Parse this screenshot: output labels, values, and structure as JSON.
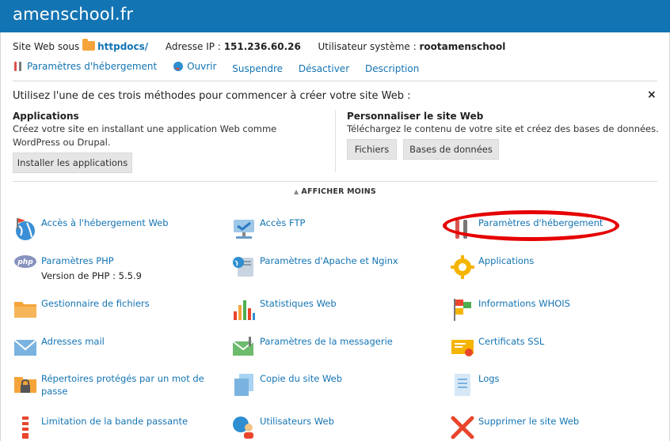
{
  "header": {
    "title": "amenschool.fr"
  },
  "info": {
    "site_label": "Site Web sous",
    "site_folder": "httpdocs/",
    "ip_label": "Adresse IP :",
    "ip_value": "151.236.60.26",
    "user_label": "Utilisateur système :",
    "user_value": "rootamenschool"
  },
  "actions": [
    {
      "label": "Paramètres d'hébergement",
      "icon": "tools-icon"
    },
    {
      "label": "Ouvrir",
      "icon": "globe-open-icon"
    },
    {
      "label": "Suspendre"
    },
    {
      "label": "Désactiver"
    },
    {
      "label": "Description"
    }
  ],
  "methods": {
    "title": "Utilisez l'une de ces trois méthodes pour commencer à créer votre site Web :",
    "close": "×",
    "applications": {
      "heading": "Applications",
      "text": "Créez votre site en installant une application Web comme WordPress ou Drupal.",
      "button": "Installer les applications"
    },
    "custom": {
      "heading": "Personnaliser le site Web",
      "text": "Téléchargez le contenu de votre site et créez des bases de données.",
      "button_files": "Fichiers",
      "button_db": "Bases de données"
    },
    "show_less": "AFFICHER MOINS"
  },
  "tiles": [
    {
      "label": "Accès à l'hébergement Web",
      "icon": "globe-flag-icon"
    },
    {
      "label": "Accès FTP",
      "icon": "ftp-icon"
    },
    {
      "label": "Paramètres d'hébergement",
      "icon": "hosting-settings-icon"
    },
    {
      "label": "Paramètres PHP",
      "sub": "Version de PHP : 5.5.9",
      "icon": "php-icon"
    },
    {
      "label": "Paramètres d'Apache et Nginx",
      "icon": "apache-nginx-icon"
    },
    {
      "label": "Applications",
      "icon": "gear-icon"
    },
    {
      "label": "Gestionnaire de fichiers",
      "icon": "folder-icon"
    },
    {
      "label": "Statistiques Web",
      "icon": "bar-chart-icon"
    },
    {
      "label": "Informations WHOIS",
      "icon": "whois-flags-icon"
    },
    {
      "label": "Adresses mail",
      "icon": "envelope-icon"
    },
    {
      "label": "Paramètres de la messagerie",
      "icon": "mail-settings-icon"
    },
    {
      "label": "Certificats SSL",
      "icon": "certificate-icon"
    },
    {
      "label": "Répertoires protégés par un mot de passe",
      "icon": "locked-folder-icon"
    },
    {
      "label": "Copie du site Web",
      "icon": "copy-icon"
    },
    {
      "label": "Logs",
      "icon": "log-file-icon"
    },
    {
      "label": "Limitation de la bande passante",
      "icon": "bandwidth-icon"
    },
    {
      "label": "Utilisateurs Web",
      "icon": "web-users-icon"
    },
    {
      "label": "Supprimer le site Web",
      "icon": "delete-x-icon"
    }
  ],
  "colors": {
    "header": "#1374b3",
    "link": "#1374b3",
    "highlight": "#e60000"
  }
}
